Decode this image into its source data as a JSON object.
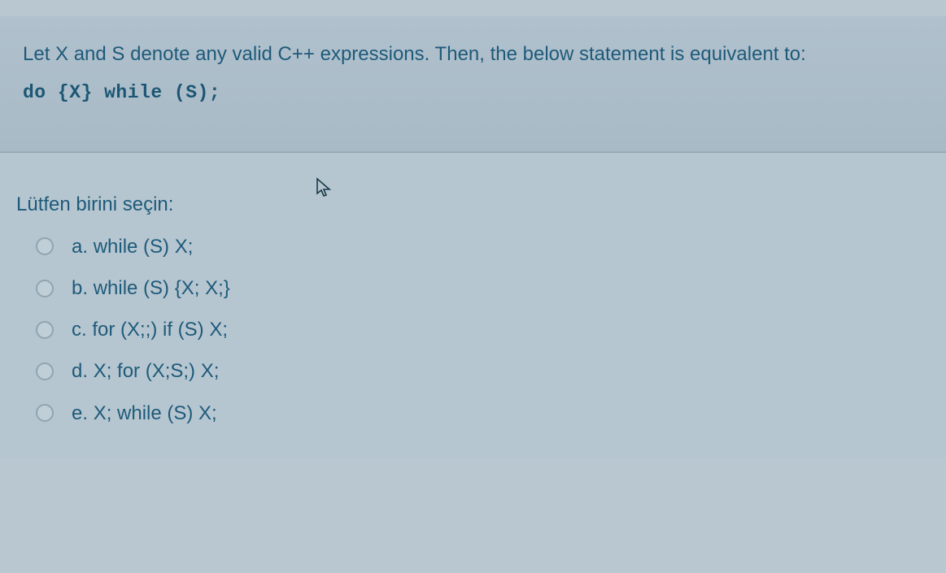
{
  "question": {
    "text": "Let X and S denote any valid C++ expressions. Then, the below statement is equivalent to:",
    "code": "do {X} while (S);"
  },
  "prompt": "Lütfen birini seçin:",
  "options": [
    {
      "letter": "a.",
      "text": "while (S) X;"
    },
    {
      "letter": "b.",
      "text": "while (S) {X; X;}"
    },
    {
      "letter": "c.",
      "text": "for (X;;) if (S) X;"
    },
    {
      "letter": "d.",
      "text": "X; for (X;S;) X;"
    },
    {
      "letter": "e.",
      "text": "X; while (S) X;"
    }
  ]
}
